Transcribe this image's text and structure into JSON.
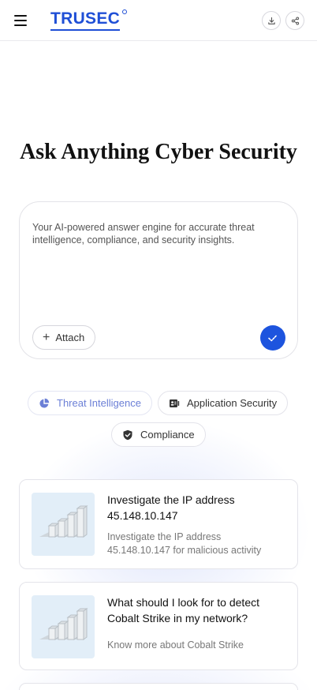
{
  "header": {
    "logo_text": "TRUSEC",
    "menu_icon": "hamburger-menu-icon",
    "download_icon": "download-icon",
    "share_icon": "share-icon"
  },
  "hero": {
    "title": "Ask Anything Cyber Security"
  },
  "prompt": {
    "placeholder": "Your AI-powered answer engine for accurate threat intelligence, compliance, and security insights.",
    "attach_label": "Attach",
    "send_icon": "send-icon"
  },
  "chips": [
    {
      "label": "Threat Intelligence",
      "icon": "pie-chart-icon",
      "active": true
    },
    {
      "label": "Application Security",
      "icon": "id-badge-icon",
      "active": false
    },
    {
      "label": "Compliance",
      "icon": "shield-check-icon",
      "active": false
    }
  ],
  "cards": [
    {
      "title": "Investigate the IP address 45.148.10.147",
      "subtitle": "Investigate the IP address 45.148.10.147 for malicious activity",
      "icon": "bar-chart-3d-icon"
    },
    {
      "title": "What should I look for to detect Cobalt Strike in my network?",
      "subtitle": "Know more about Cobalt Strike",
      "icon": "bar-chart-3d-icon"
    }
  ],
  "colors": {
    "brand": "#1f4fd6",
    "send_button": "#1d54de",
    "active_chip": "#6b7fd6",
    "thumb_bg": "#e2eef8"
  }
}
